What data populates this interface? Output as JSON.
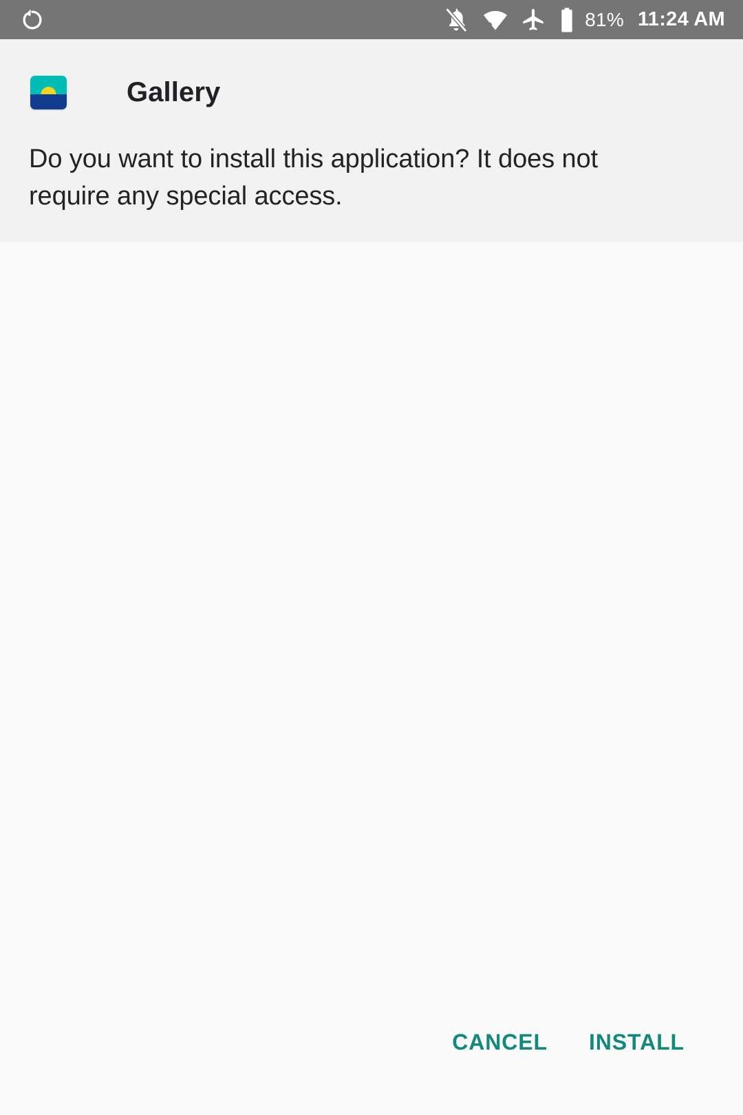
{
  "status_bar": {
    "background_color": "#757575",
    "rotate_icon": "screen-rotation-icon",
    "silent_icon": "notifications-off-icon",
    "wifi_icon": "wifi-icon",
    "airplane_icon": "airplane-mode-icon",
    "battery_icon": "battery-icon",
    "battery_percent": "81%",
    "clock": "11:24 AM"
  },
  "dialog": {
    "app_icon_name": "gallery-app-icon",
    "app_title": "Gallery",
    "prompt": "Do you want to install this application? It does not require any special access.",
    "icon_colors": {
      "sky": "#00BEB6",
      "sun": "#F4D422",
      "sea": "#123C8F"
    },
    "panel_color": "#F2F2F2",
    "body_color": "#FAFAFA"
  },
  "actions": {
    "accent_color": "#11897B",
    "cancel_label": "CANCEL",
    "install_label": "INSTALL"
  }
}
